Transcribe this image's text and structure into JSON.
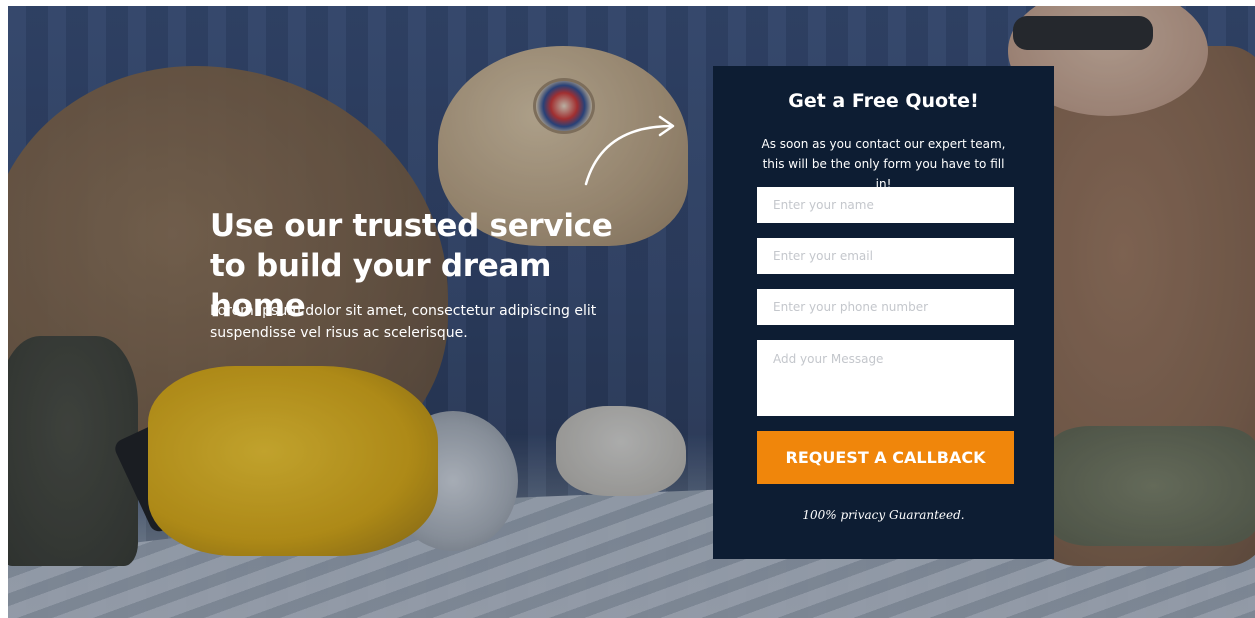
{
  "hero": {
    "headline": "Use our trusted service to build your dream home",
    "subtext": "Lorem ipsum dolor sit amet, consectetur adipiscing elit suspendisse vel risus ac scelerisque."
  },
  "form": {
    "title": "Get a Free Quote!",
    "description": "As soon as you contact our expert team, this will be the only form you have to fill in!",
    "name_placeholder": "Enter your name",
    "email_placeholder": "Enter your email",
    "phone_placeholder": "Enter your phone number",
    "message_placeholder": "Add your Message",
    "submit_label": "REQUEST A CALLBACK",
    "privacy_note": "100% privacy Guaranteed."
  },
  "colors": {
    "panel_bg": "#0d1d33",
    "accent": "#f0860b",
    "text": "#ffffff"
  },
  "icons": {
    "arrow": "curved-arrow-icon"
  }
}
